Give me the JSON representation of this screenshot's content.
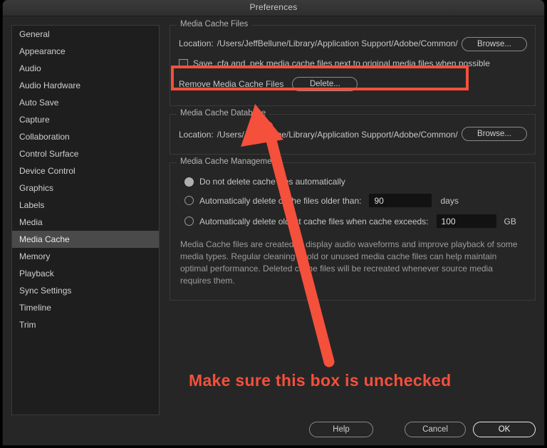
{
  "window": {
    "title": "Preferences"
  },
  "sidebar": {
    "items": [
      {
        "label": "General",
        "selected": false
      },
      {
        "label": "Appearance",
        "selected": false
      },
      {
        "label": "Audio",
        "selected": false
      },
      {
        "label": "Audio Hardware",
        "selected": false
      },
      {
        "label": "Auto Save",
        "selected": false
      },
      {
        "label": "Capture",
        "selected": false
      },
      {
        "label": "Collaboration",
        "selected": false
      },
      {
        "label": "Control Surface",
        "selected": false
      },
      {
        "label": "Device Control",
        "selected": false
      },
      {
        "label": "Graphics",
        "selected": false
      },
      {
        "label": "Labels",
        "selected": false
      },
      {
        "label": "Media",
        "selected": false
      },
      {
        "label": "Media Cache",
        "selected": true
      },
      {
        "label": "Memory",
        "selected": false
      },
      {
        "label": "Playback",
        "selected": false
      },
      {
        "label": "Sync Settings",
        "selected": false
      },
      {
        "label": "Timeline",
        "selected": false
      },
      {
        "label": "Trim",
        "selected": false
      }
    ]
  },
  "media_cache_files": {
    "group_title": "Media Cache Files",
    "location_label": "Location:",
    "location_value": "/Users/JeffBellune/Library/Application Support/Adobe/Common/",
    "browse_label": "Browse...",
    "save_checkbox_label": "Save .cfa and .pek media cache files next to original media files when possible",
    "save_checkbox_checked": false,
    "remove_label": "Remove Media Cache Files",
    "delete_label": "Delete..."
  },
  "media_cache_database": {
    "group_title": "Media Cache Database",
    "location_label": "Location:",
    "location_value": "/Users/JeffBellune/Library/Application Support/Adobe/Common/",
    "browse_label": "Browse..."
  },
  "media_cache_management": {
    "group_title": "Media Cache Management",
    "option_never_label": "Do not delete cache files automatically",
    "option_never_selected": true,
    "option_older_label": "Automatically delete cache files older than:",
    "option_older_selected": false,
    "days_value": "90",
    "days_unit": "days",
    "option_exceeds_label": "Automatically delete oldest cache files when cache exceeds:",
    "option_exceeds_selected": false,
    "size_value": "100",
    "size_unit": "GB",
    "description": "Media Cache files are created to display audio waveforms and improve playback of some media types.  Regular cleaning of old or unused media cache files can help maintain optimal performance. Deleted cache files will be recreated whenever source media requires them."
  },
  "footer": {
    "help_label": "Help",
    "cancel_label": "Cancel",
    "ok_label": "OK"
  },
  "annotation": {
    "callout_text": "Make sure this box is unchecked",
    "color": "#f4503c"
  }
}
